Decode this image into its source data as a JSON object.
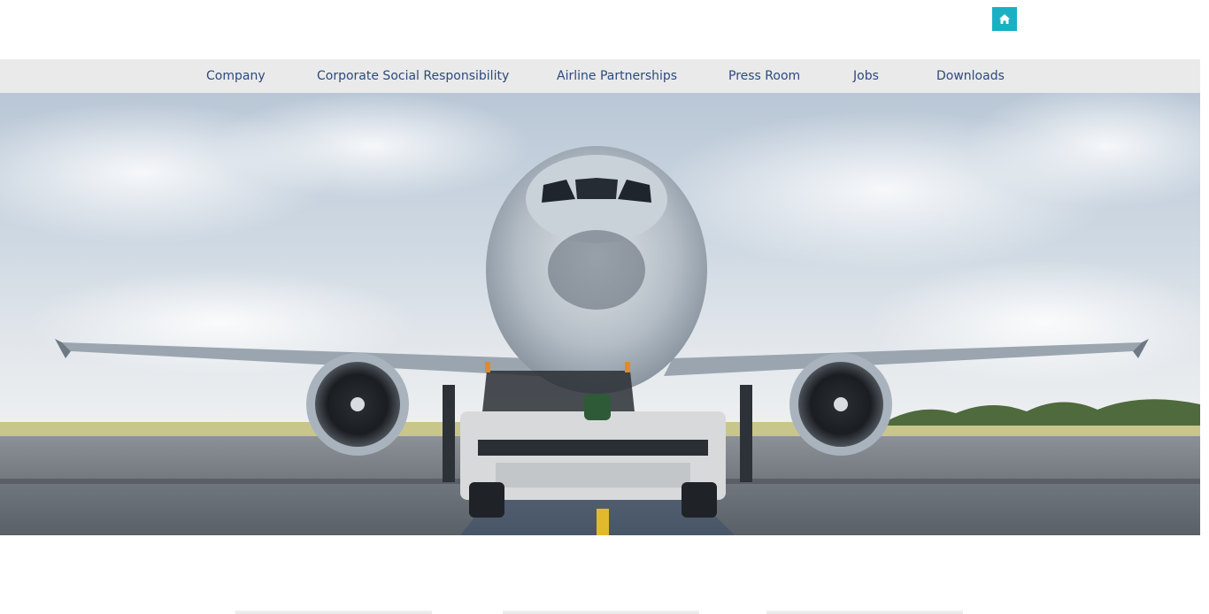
{
  "header": {
    "home_icon": "home-icon",
    "accent_color": "#1ab0c4"
  },
  "nav": {
    "items": [
      {
        "label": "Company"
      },
      {
        "label": "Corporate Social Responsibility"
      },
      {
        "label": "Airline Partnerships"
      },
      {
        "label": "Press Room"
      },
      {
        "label": "Jobs"
      },
      {
        "label": "Downloads"
      }
    ],
    "text_color": "#2c4a7c",
    "background": "#eaeaea"
  },
  "hero": {
    "image": "airliner-front-view-with-pushback-tug"
  }
}
